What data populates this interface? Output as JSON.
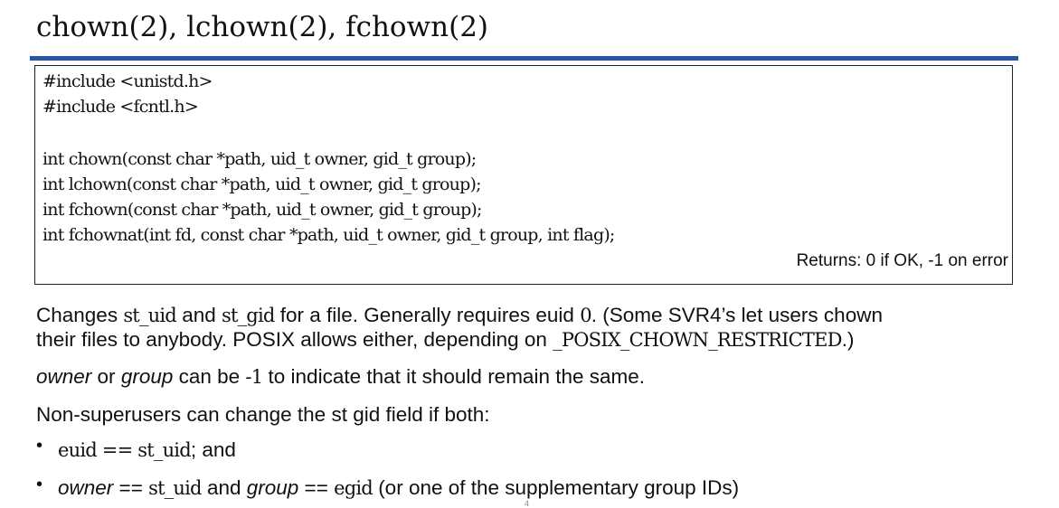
{
  "title": "chown(2), lchown(2), fchown(2)",
  "code": {
    "lines": [
      "#include <unistd.h>",
      "#include <fcntl.h>",
      "",
      "int chown(const char *path, uid_t owner, gid_t group);",
      "int lchown(const char *path, uid_t owner, gid_t group);",
      "int fchown(const char *path, uid_t owner, gid_t group);",
      "int fchownat(int fd, const char *path, uid_t owner, gid_t group, int flag);"
    ],
    "returns": "Returns: 0 if OK, -1 on error"
  },
  "para1": {
    "p1": "Changes ",
    "c1": "st_uid",
    "p2": " and ",
    "c2": "st_gid",
    "p3": " for a file. Generally requires euid ",
    "c3": "0",
    "p4": ". (Some SVR4’s let users chown",
    "line2a": "their files to anybody. POSIX allows either, depending on ",
    "c4": "_POSIX_CHOWN_RESTRICTED",
    "line2b": ".)"
  },
  "para2": {
    "e1": "owner",
    "p1": " or ",
    "e2": "group",
    "p2": " can be ",
    "c1": "-1",
    "p3": " to indicate that it should remain the same."
  },
  "para3": "Non-superusers can change the st gid field if both:",
  "bullet_symbol": "•",
  "bullet1": {
    "c1": "euid == st_uid",
    "p1": "; and"
  },
  "bullet2": {
    "e1": "owner",
    "p1": " == ",
    "c1": "st_uid",
    "p2": " and ",
    "e2": "group",
    "p3": " == ",
    "c2": "egid",
    "p4": " (or one of the supplementary group IDs)"
  },
  "page_number": "4"
}
